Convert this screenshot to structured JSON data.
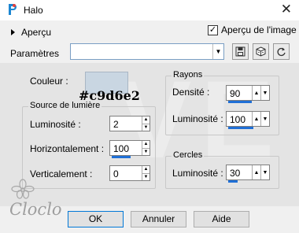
{
  "window": {
    "title": "Halo"
  },
  "preview": {
    "toggle_label": "Aperçu",
    "image_preview_label": "Aperçu de l'image",
    "image_preview_checked": true
  },
  "params": {
    "label": "Paramètres",
    "preset_value": ""
  },
  "color": {
    "label": "Couleur :",
    "value": "#c9d6e2",
    "hex_text": "#c9d6e2"
  },
  "light_source": {
    "title": "Source de lumière",
    "luminosite": {
      "label": "Luminosité :",
      "value": "2"
    },
    "horizontal": {
      "label": "Horizontalement :",
      "value": "100"
    },
    "vertical": {
      "label": "Verticalement :",
      "value": "0"
    }
  },
  "rays": {
    "title": "Rayons",
    "density": {
      "label": "Densité :",
      "value": "90",
      "fill": 0.9
    },
    "luminosite": {
      "label": "Luminosité :",
      "value": "100",
      "fill": 1.0
    }
  },
  "circles": {
    "title": "Cercles",
    "luminosite": {
      "label": "Luminosité :",
      "value": "30",
      "fill": 0.3
    }
  },
  "buttons": {
    "ok": "OK",
    "cancel": "Annuler",
    "help": "Aide"
  },
  "watermark": {
    "text": "Cloclo"
  },
  "icons": [
    "app-icon",
    "close-icon",
    "expand-triangle-icon",
    "dropdown-arrow-icon",
    "save-icon",
    "randomize-icon",
    "reset-icon",
    "spin-up-icon",
    "spin-down-icon",
    "flower-logo-icon"
  ],
  "colors": {
    "accent": "#1f6fd6",
    "swatch": "#c9d6e2"
  }
}
